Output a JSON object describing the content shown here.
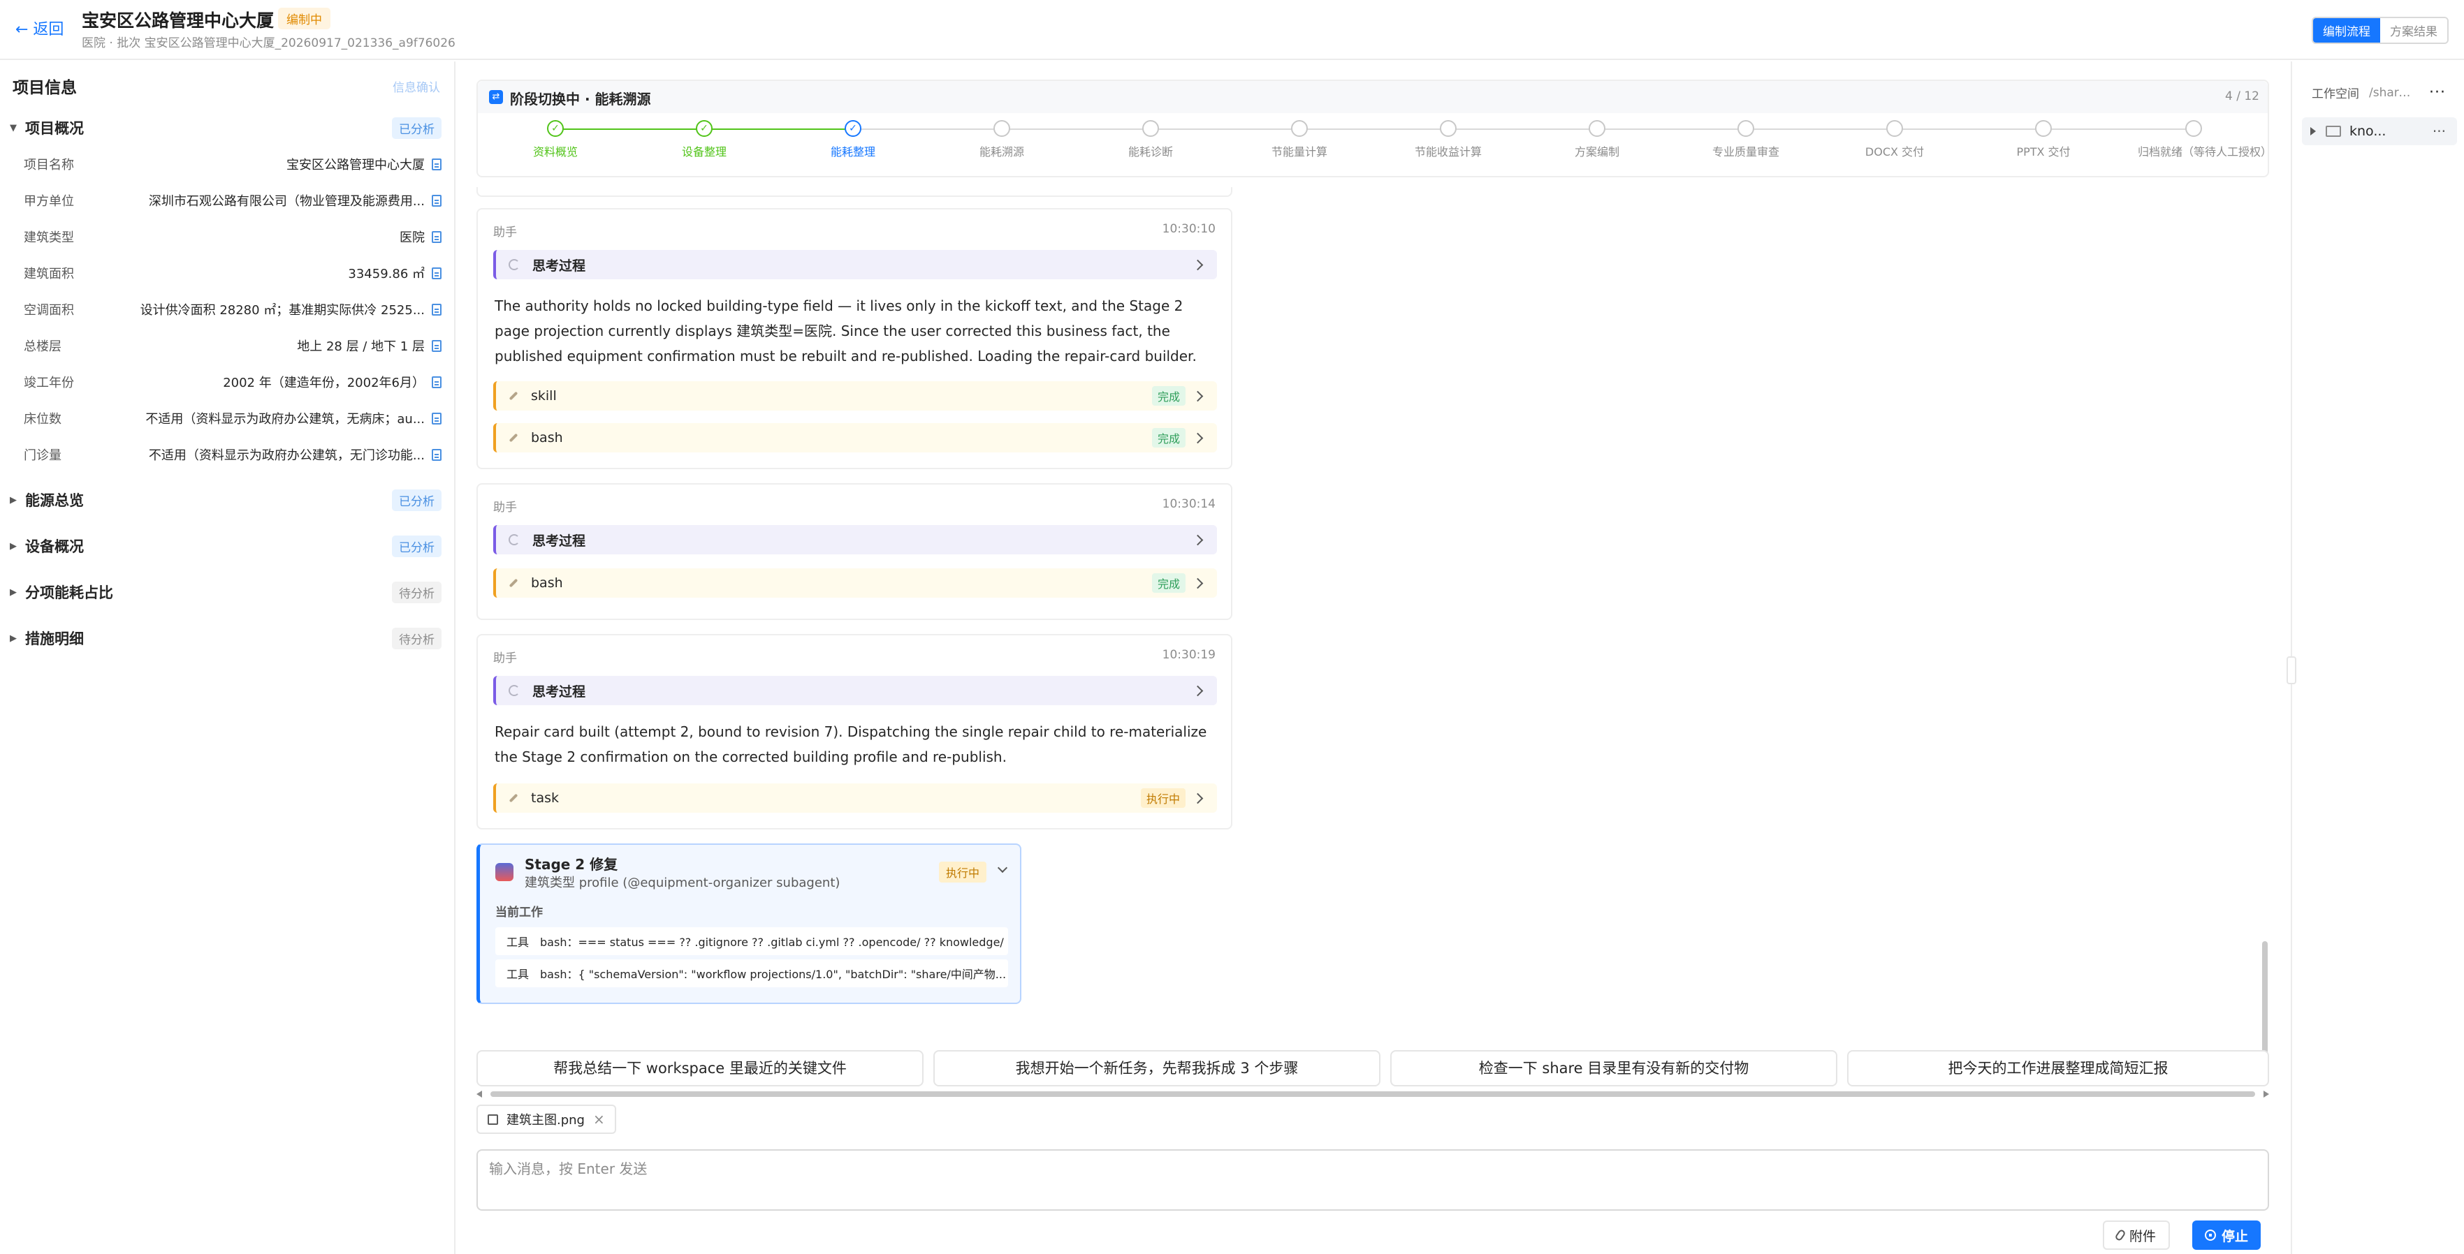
{
  "header": {
    "back_label": "← 返回",
    "title": "宝安区公路管理中心大厦",
    "status_badge": "编制中",
    "subtitle": "医院 · 批次 宝安区公路管理中心大厦_20260917_021336_a9f76026",
    "view_tabs": [
      "编制流程",
      "方案结果"
    ]
  },
  "left_panel": {
    "title": "项目信息",
    "confirm_link": "信息确认",
    "overview": {
      "label": "项目概况",
      "status": "已分析",
      "fields": [
        {
          "key": "项目名称",
          "value": "宝安区公路管理中心大厦"
        },
        {
          "key": "甲方单位",
          "value": "深圳市石观公路有限公司（物业管理及能源费用..."
        },
        {
          "key": "建筑类型",
          "value": "医院"
        },
        {
          "key": "建筑面积",
          "value": "33459.86 ㎡"
        },
        {
          "key": "空调面积",
          "value": "设计供冷面积 28280 ㎡；基准期实际供冷 2525..."
        },
        {
          "key": "总楼层",
          "value": "地上 28 层 / 地下 1 层"
        },
        {
          "key": "竣工年份",
          "value": "2002 年（建造年份，2002年6月）"
        },
        {
          "key": "床位数",
          "value": "不适用（资料显示为政府办公建筑，无病床；au..."
        },
        {
          "key": "门诊量",
          "value": "不适用（资料显示为政府办公建筑，无门诊功能..."
        }
      ]
    },
    "sections": [
      {
        "label": "能源总览",
        "status": "已分析"
      },
      {
        "label": "设备概况",
        "status": "已分析"
      },
      {
        "label": "分项能耗占比",
        "status": "待分析"
      },
      {
        "label": "措施明细",
        "status": "待分析"
      }
    ]
  },
  "stage": {
    "title": "阶段切换中 · 能耗溯源",
    "counter": "4 / 12",
    "steps": [
      "资料概览",
      "设备整理",
      "能耗整理",
      "能耗溯源",
      "能耗诊断",
      "节能量计算",
      "节能收益计算",
      "方案编制",
      "专业质量审查",
      "DOCX 交付",
      "PPTX 交付",
      "归档就绪（等待人工授权）"
    ]
  },
  "messages": [
    {
      "who": "助手",
      "time": "10:30:10",
      "think_label": "思考过程",
      "text": "The authority holds no locked building-type field — it lives only in the kickoff text, and the Stage 2 page projection currently displays 建筑类型=医院. Since the user corrected this business fact, the published equipment confirmation must be rebuilt and re-published. Loading the repair-card builder.",
      "tools": [
        {
          "name": "skill",
          "status": "完成"
        },
        {
          "name": "bash",
          "status": "完成"
        }
      ]
    },
    {
      "who": "助手",
      "time": "10:30:14",
      "think_label": "思考过程",
      "tools": [
        {
          "name": "bash",
          "status": "完成"
        }
      ]
    },
    {
      "who": "助手",
      "time": "10:30:19",
      "think_label": "思考过程",
      "text": "Repair card built (attempt 2, bound to revision 7). Dispatching the single repair child to re-materialize the Stage 2 confirmation on the corrected building profile and re-publish.",
      "tools": [
        {
          "name": "task",
          "status": "执行中"
        }
      ]
    }
  ],
  "subagent": {
    "name": "Stage 2 修复",
    "desc": "建筑类型 profile (@equipment-organizer subagent)",
    "status": "执行中",
    "current_work_label": "当前工作",
    "tool_lines": [
      {
        "prefix": "工具",
        "text": "bash：=== status === ?? .gitignore ?? .gitlab ci.yml ?? .opencode/ ?? knowledge/"
      },
      {
        "prefix": "工具",
        "text": "bash：{ \"schemaVersion\": \"workflow projections/1.0\", \"batchDir\": \"share/中间产物..."
      }
    ]
  },
  "suggestions": [
    "帮我总结一下 workspace 里最近的关键文件",
    "我想开始一个新任务，先帮我拆成 3 个步骤",
    "检查一下 share 目录里有没有新的交付物",
    "把今天的工作进展整理成简短汇报"
  ],
  "composer": {
    "attachment_name": "建筑主图.png",
    "placeholder": "输入消息，按 Enter 发送",
    "attach_label": "附件",
    "stop_label": "停止"
  },
  "workspace": {
    "title": "工作空间",
    "path": "/share...",
    "node_name": "kno...",
    "more": "···"
  }
}
